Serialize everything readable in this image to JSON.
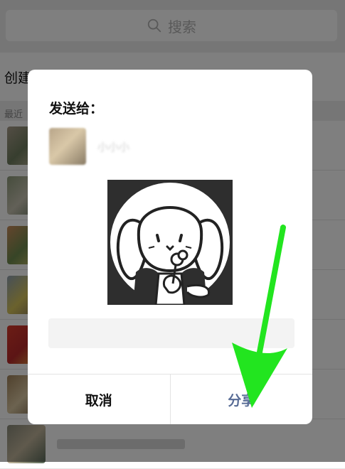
{
  "search": {
    "placeholder": "搜索"
  },
  "create_label": "创建",
  "recent_label": "最近",
  "dialog": {
    "title": "发送给：",
    "recipient_name": "小小小",
    "cancel_label": "取消",
    "share_label": "分享"
  },
  "colors": {
    "share_text": "#576b95",
    "annotation_arrow": "#22e51f",
    "overlay": "rgba(0,0,0,0.5)"
  },
  "icons": {
    "search": "search-icon",
    "annotation": "arrow-down-icon"
  }
}
